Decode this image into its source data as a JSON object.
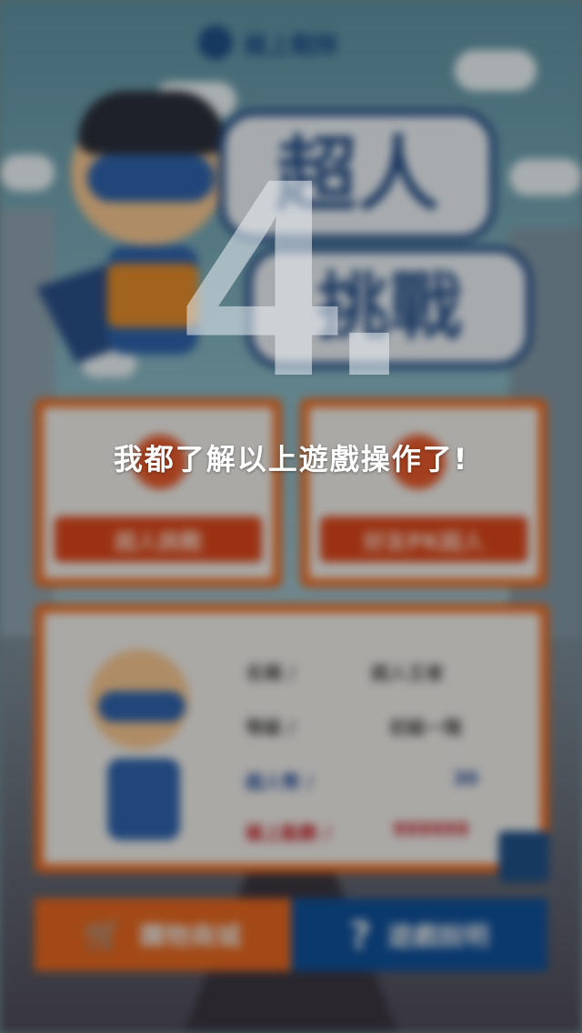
{
  "app": {
    "logo_text": "極上戰隊"
  },
  "overlay": {
    "countdown": "4.",
    "message": "我都了解以上遊戲操作了!"
  },
  "background": {
    "game_title_line1": "超人",
    "game_title_line2": "挑戰",
    "card_left_button": "超人挑戰",
    "card_right_button": "好友PK超人",
    "profile": {
      "row1_label": "名稱 /",
      "row1_value": "超人王者",
      "row2_label": "等級 /",
      "row2_value": "初級一階",
      "row3_label": "超人幣 /",
      "row3_value": "30",
      "row4_label": "極上點數 /",
      "row4_value": "999999"
    },
    "shop_button": "購物商城",
    "help_button": "遊戲說明"
  },
  "colors": {
    "brand_blue": "#1f4f86",
    "brand_orange": "#e86a22"
  }
}
